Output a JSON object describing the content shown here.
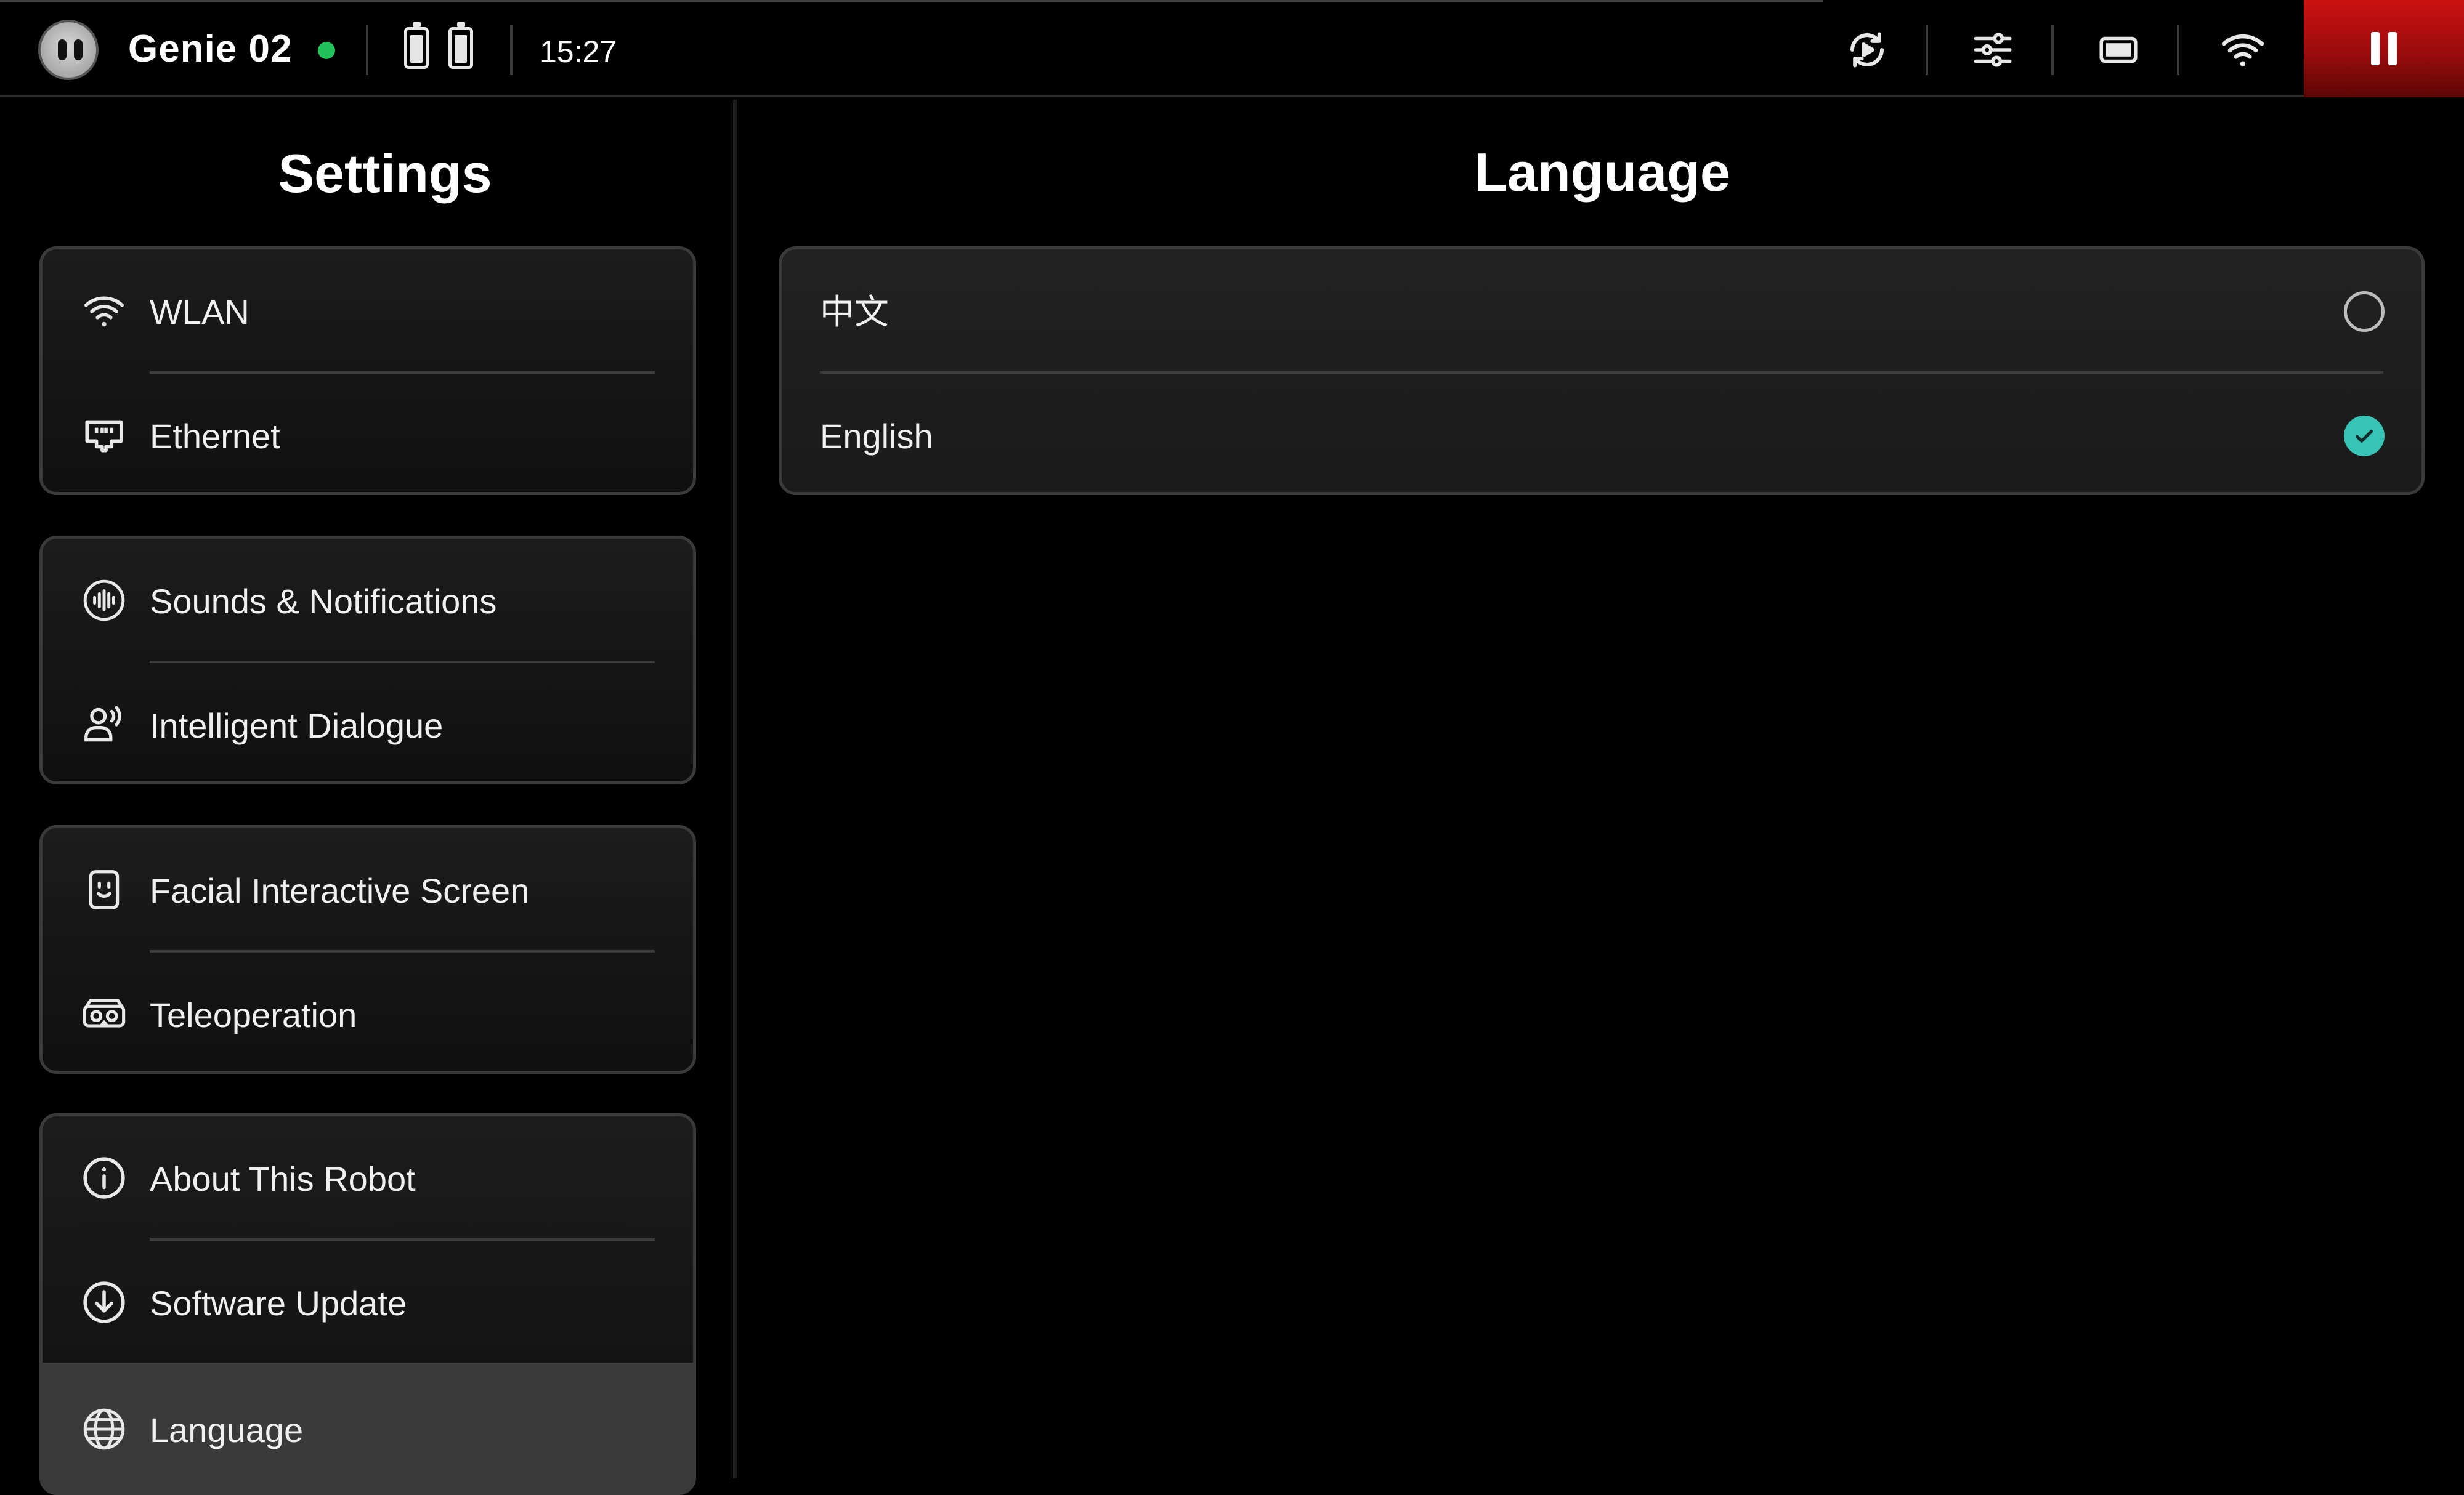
{
  "statusbar": {
    "robot_name": "Genie 02",
    "connection_status_color": "#20c05a",
    "time": "15:27",
    "icons": [
      "robot-avatar",
      "battery-icon",
      "battery-icon",
      "replay-icon",
      "sliders-icon",
      "display-icon",
      "wifi-icon",
      "pause-icon"
    ],
    "pause_color": "#cc1111"
  },
  "sidebar": {
    "title": "Settings",
    "groups": [
      {
        "items": [
          {
            "label": "WLAN",
            "icon": "wifi-icon"
          },
          {
            "label": "Ethernet",
            "icon": "ethernet-icon"
          }
        ]
      },
      {
        "items": [
          {
            "label": "Sounds & Notifications",
            "icon": "sound-wave-icon"
          },
          {
            "label": "Intelligent Dialogue",
            "icon": "voice-person-icon"
          }
        ]
      },
      {
        "items": [
          {
            "label": "Facial Interactive Screen",
            "icon": "face-screen-icon"
          },
          {
            "label": "Teleoperation",
            "icon": "vr-headset-icon"
          }
        ]
      },
      {
        "items": [
          {
            "label": "About This Robot",
            "icon": "info-icon"
          },
          {
            "label": "Software Update",
            "icon": "download-icon"
          },
          {
            "label": "Language",
            "icon": "globe-icon",
            "selected": true
          }
        ]
      }
    ]
  },
  "main": {
    "title": "Language",
    "options": [
      {
        "label": "中文",
        "selected": false
      },
      {
        "label": "English",
        "selected": true
      }
    ],
    "accent_color": "#37c3b5"
  }
}
